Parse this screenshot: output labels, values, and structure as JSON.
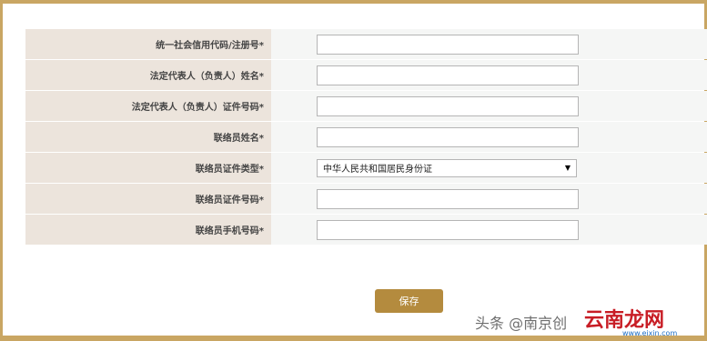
{
  "form": {
    "rows": [
      {
        "label": "统一社会信用代码/注册号*",
        "type": "text",
        "value": ""
      },
      {
        "label": "法定代表人（负责人）姓名*",
        "type": "text",
        "value": ""
      },
      {
        "label": "法定代表人（负责人）证件号码*",
        "type": "text",
        "value": ""
      },
      {
        "label": "联络员姓名*",
        "type": "text",
        "value": ""
      },
      {
        "label": "联络员证件类型*",
        "type": "select",
        "value": "中华人民共和国居民身份证"
      },
      {
        "label": "联络员证件号码*",
        "type": "text",
        "value": ""
      },
      {
        "label": "联络员手机号码*",
        "type": "text",
        "value": ""
      }
    ],
    "save_label": "保存"
  },
  "watermark": {
    "text": "头条 @南京创",
    "logo": "云南龙网",
    "logo_sub": "www.eixin.com"
  },
  "colors": {
    "frame": "#c9a663",
    "label_bg": "#ece4dc",
    "button": "#b48b3e"
  },
  "icons": {
    "select_arrow": "dropdown-arrow-icon"
  }
}
